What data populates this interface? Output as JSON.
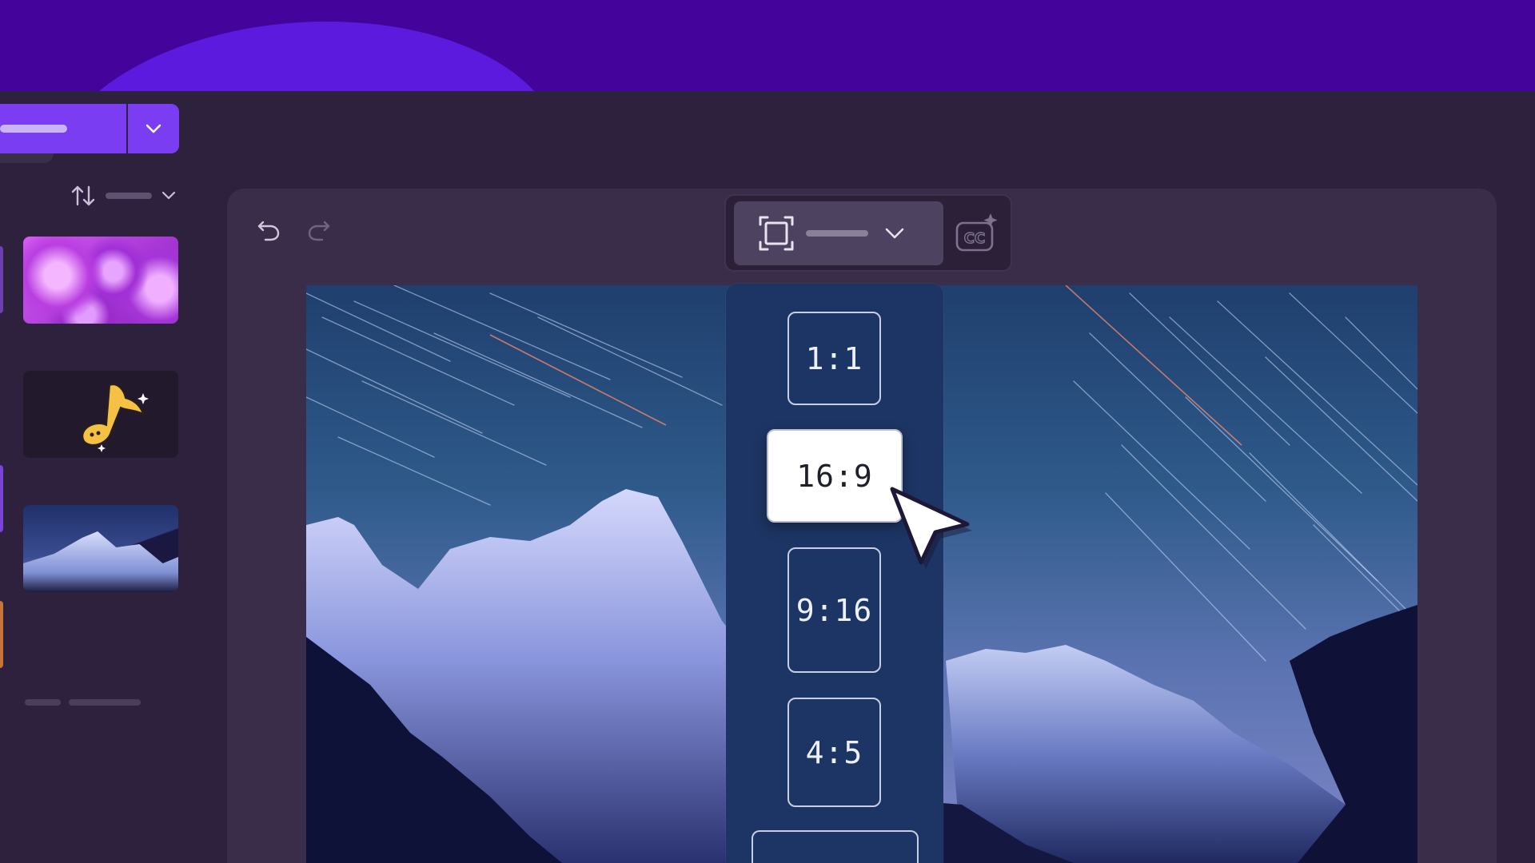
{
  "colors": {
    "brand_band": "#44049b",
    "primary_button": "#7b3df2",
    "app_background": "#2d213d",
    "editor_panel": "#3a2d4a",
    "dropdown_background": "#1d3564",
    "selected_option": "#ffffff"
  },
  "toolbar": {
    "undo_icon": "undo-icon",
    "redo_icon": "redo-icon",
    "aspect_ratio_icon": "aspect-ratio-frame-icon",
    "dropdown_icon": "chevron-down-icon",
    "captions_icon": "auto-captions-cc-icon"
  },
  "aspect_menu": {
    "options": [
      {
        "label": "1:1",
        "selected": false
      },
      {
        "label": "16:9",
        "selected": true
      },
      {
        "label": "9:16",
        "selected": false
      },
      {
        "label": "4:5",
        "selected": false
      }
    ]
  },
  "media_panel": {
    "sort_icon": "sort-arrows-icon",
    "items": [
      {
        "kind": "video",
        "subject": "purple-bubbles"
      },
      {
        "kind": "audio",
        "icon": "music-note-icon"
      },
      {
        "kind": "image",
        "subject": "mountain-star-trails"
      }
    ]
  }
}
